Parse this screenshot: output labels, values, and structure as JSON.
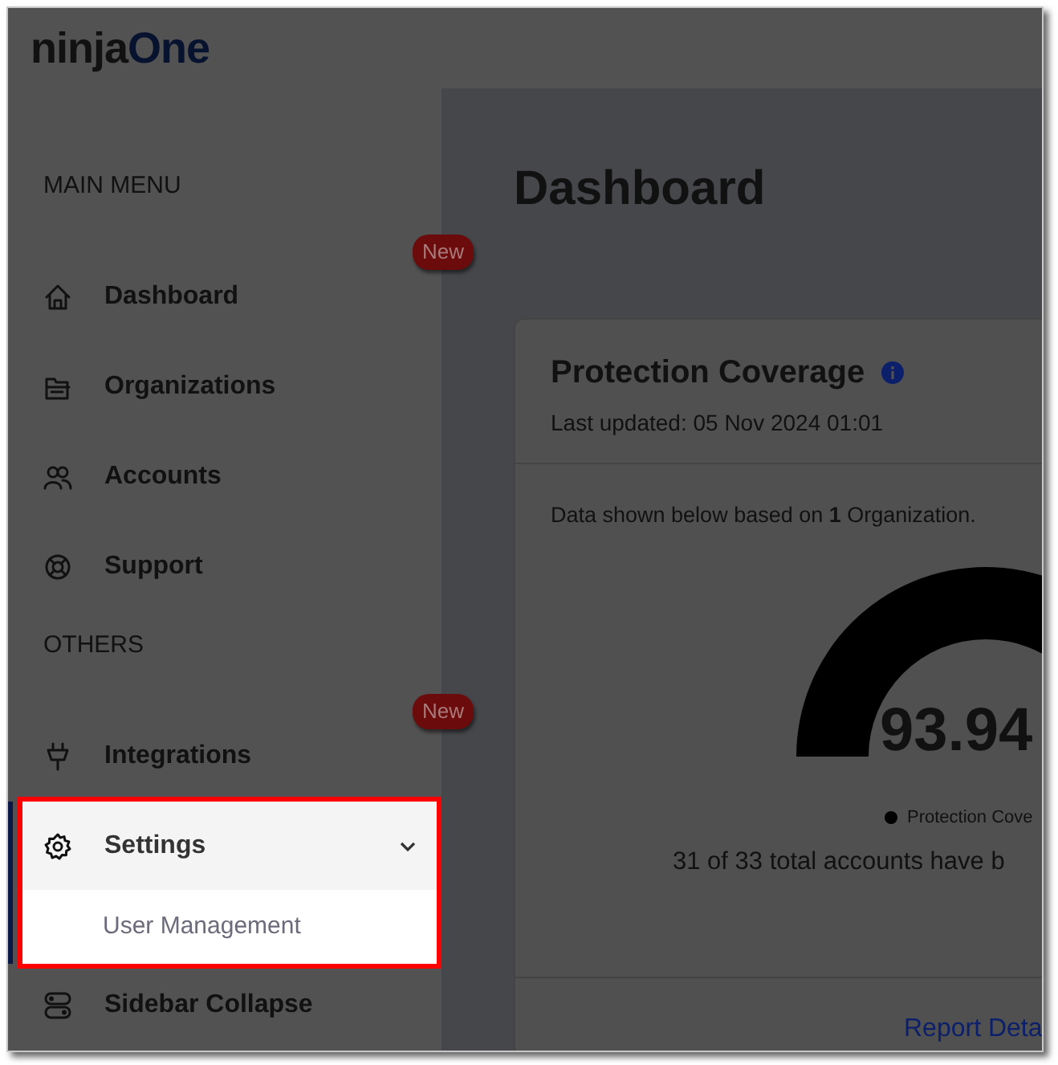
{
  "logo": {
    "prefix": "ninja",
    "suffix": "One"
  },
  "sidebar": {
    "sections": [
      {
        "heading": "MAIN MENU",
        "items": [
          {
            "label": "Dashboard",
            "badge": "New",
            "selected": false
          },
          {
            "label": "Organizations",
            "selected": false
          },
          {
            "label": "Accounts",
            "selected": false
          },
          {
            "label": "Support",
            "selected": false
          }
        ]
      },
      {
        "heading": "OTHERS",
        "items": [
          {
            "label": "Integrations",
            "badge": "New",
            "selected": false
          },
          {
            "label": "Settings",
            "selected": true,
            "highlighted": true,
            "expanded": true,
            "children": [
              {
                "label": "User Management"
              }
            ]
          }
        ]
      }
    ],
    "footer": {
      "label": "Sidebar Collapse"
    }
  },
  "page_title": "Dashboard",
  "card": {
    "title": "Protection Coverage",
    "updated": "Last updated: 05 Nov 2024 01:01",
    "note": "Data shown below based on **1** Organization.",
    "gauge_value": "93.94",
    "legend": "Protection Cove",
    "summary": "31 of 33 total accounts have b",
    "link": "Report Deta"
  }
}
